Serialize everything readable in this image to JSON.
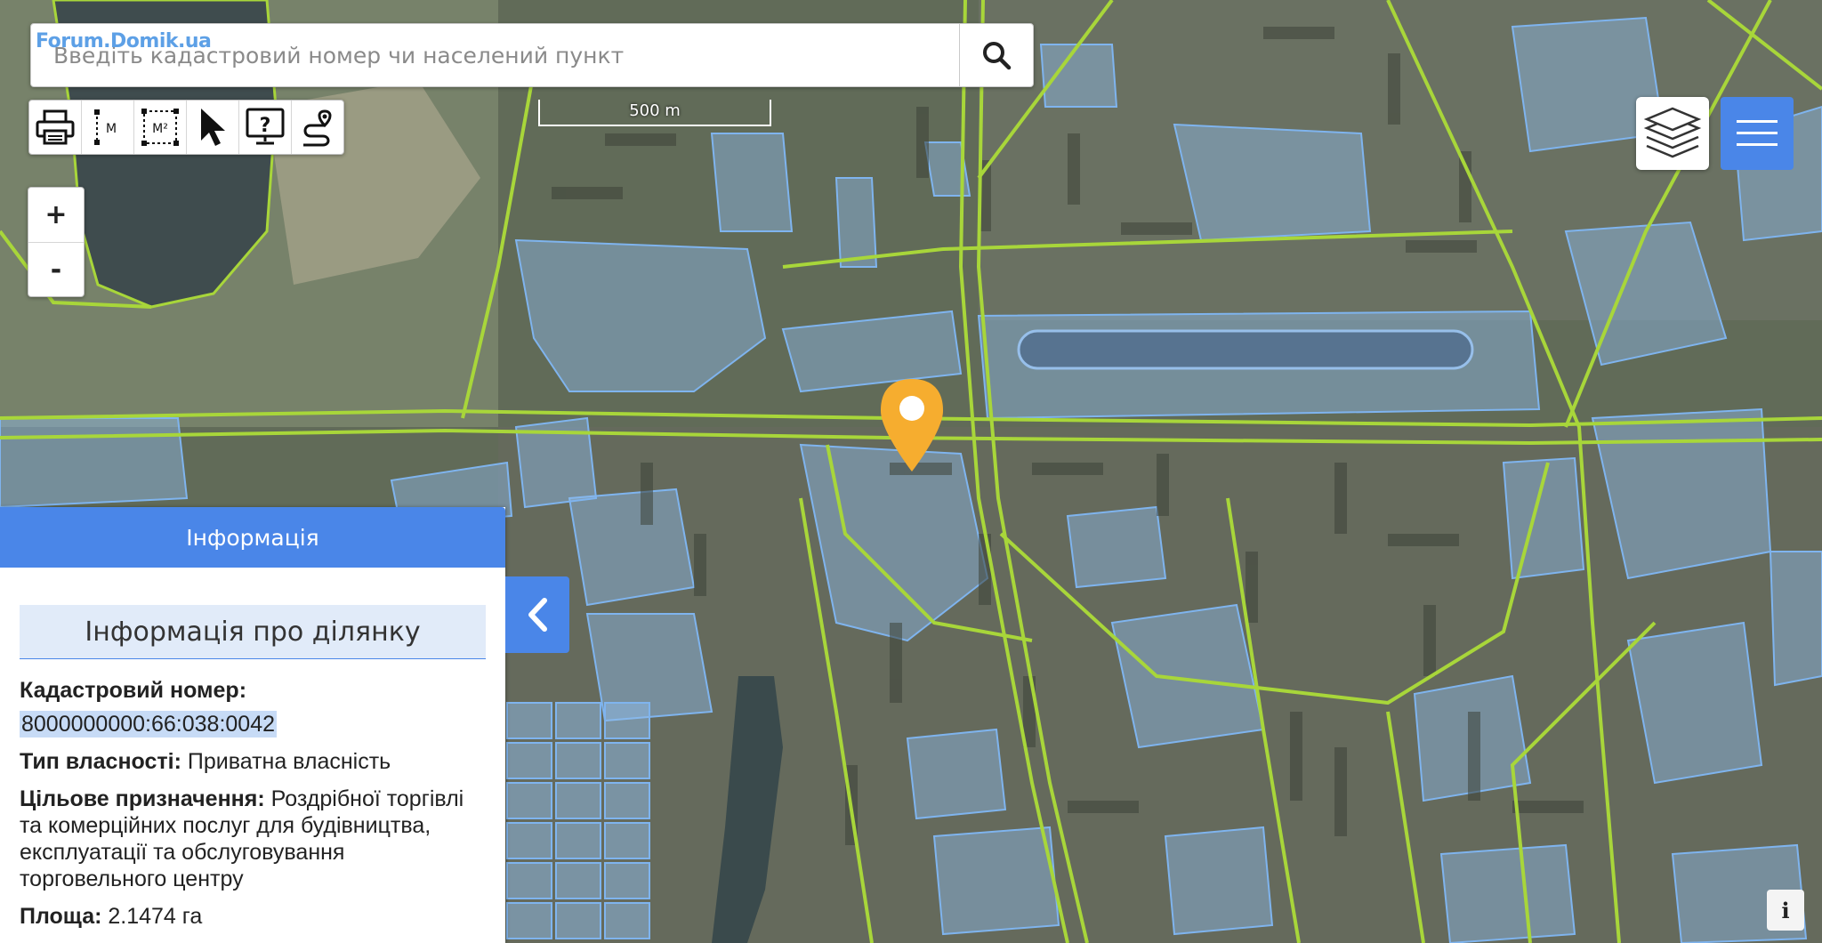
{
  "search": {
    "placeholder": "Введіть кадастровий номер чи населений пункт",
    "watermark": "Forum.Domik.ua"
  },
  "toolbar": {
    "tools": [
      {
        "icon": "printer-icon"
      },
      {
        "icon": "measure-distance-icon",
        "label": "M"
      },
      {
        "icon": "measure-area-icon",
        "label": "M²"
      },
      {
        "icon": "cursor-icon"
      },
      {
        "icon": "help-icon",
        "label": "?"
      },
      {
        "icon": "route-icon"
      }
    ]
  },
  "scale": {
    "label": "500 m"
  },
  "zoom": {
    "in": "+",
    "out": "-"
  },
  "panel": {
    "header": "Інформація",
    "title": "Інформація про ділянку",
    "cadastral_label": "Кадастровий номер:",
    "cadastral_value": "8000000000:66:038:0042",
    "ownership_label": "Тип власності:",
    "ownership_value": "Приватна власність",
    "purpose_label": "Цільове призначення:",
    "purpose_value": "Роздрібної торгівлі та комерційних послуг для будівництва, експлуатації та обслуговування торговельного центру",
    "area_label": "Площа:",
    "area_value": "2.1474 га"
  },
  "info_button": "i",
  "colors": {
    "accent": "#4a86e8",
    "marker": "#f6ad2f",
    "parcel_fill": "#8fbbea",
    "road_line": "#a8d63a"
  }
}
